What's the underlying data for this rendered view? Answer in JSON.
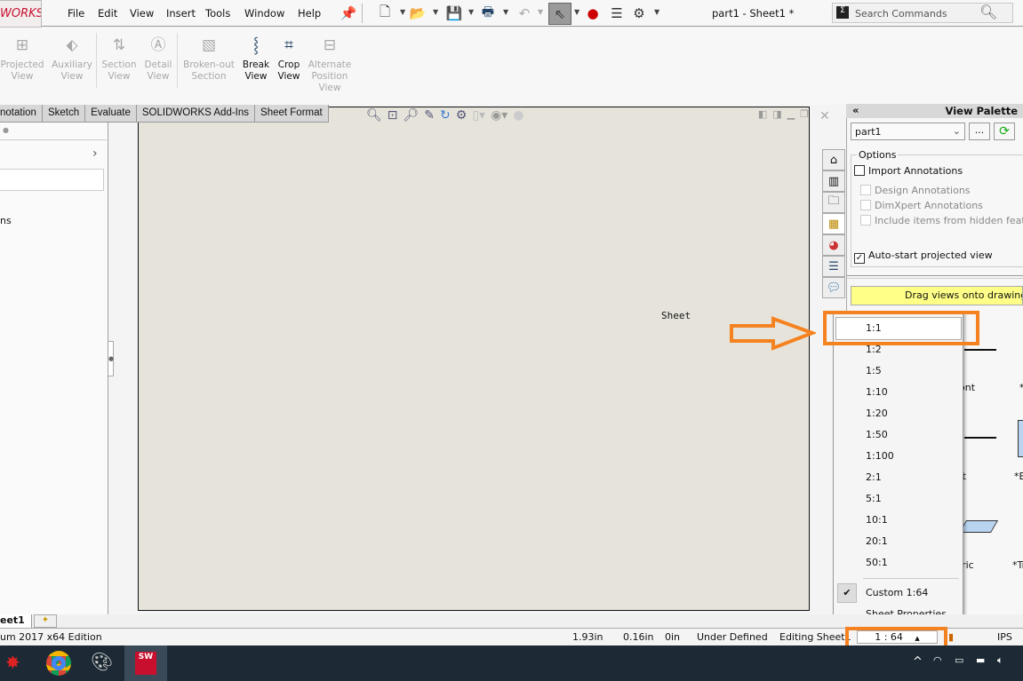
{
  "app": {
    "logo_text": "WORKS",
    "document_title": "part1 - Sheet1 *"
  },
  "menu": [
    "File",
    "Edit",
    "View",
    "Insert",
    "Tools",
    "Window",
    "Help"
  ],
  "search": {
    "placeholder": "Search Commands"
  },
  "ribbon": [
    {
      "label": "Projected View",
      "enabled": false
    },
    {
      "label": "Auxiliary View",
      "enabled": false
    },
    {
      "label": "Section View",
      "enabled": false
    },
    {
      "label": "Detail View",
      "enabled": false
    },
    {
      "label": "Broken-out Section",
      "enabled": false
    },
    {
      "label": "Break View",
      "enabled": true
    },
    {
      "label": "Crop View",
      "enabled": true
    },
    {
      "label": "Alternate Position View",
      "enabled": false
    }
  ],
  "tabs": [
    "notation",
    "Sketch",
    "Evaluate",
    "SOLIDWORKS Add-Ins",
    "Sheet Format"
  ],
  "left_panel": {
    "partial_text": "ns"
  },
  "graphics": {
    "sheet_label": "Sheet"
  },
  "view_palette": {
    "title": "View Palette",
    "collapse": "«",
    "part_select": "part1",
    "browse": "...",
    "options_label": "Options",
    "import_annotations": {
      "label": "Import Annotations",
      "checked": false
    },
    "sub_options": [
      {
        "label": "Design Annotations",
        "checked": false
      },
      {
        "label": "DimXpert Annotations",
        "checked": false
      },
      {
        "label": "Include items from hidden features",
        "checked": false
      }
    ],
    "auto_start": {
      "label": "Auto-start projected view",
      "checked": true
    },
    "hint": "Drag views onto drawing sheet",
    "view_labels": [
      "ont",
      "*",
      "ft",
      "*B",
      "etric",
      "*Tr"
    ]
  },
  "scale_dropdown": {
    "options": [
      "1:1",
      "1:2",
      "1:5",
      "1:10",
      "1:20",
      "1:50",
      "1:100",
      "2:1",
      "5:1",
      "10:1",
      "20:1",
      "50:1"
    ],
    "highlighted": "1:1",
    "custom": {
      "label": "Custom 1:64",
      "checked": true
    },
    "sheet_properties": "Sheet Properties..."
  },
  "sheet_tabs": [
    "eet1"
  ],
  "status_bar": {
    "edition": "um 2017 x64 Edition",
    "x": "1.93in",
    "y": "0.16in",
    "z": "0in",
    "state": "Under Defined",
    "editing": "Editing Sheet1",
    "scale": "1 : 64",
    "units": "IPS"
  },
  "colors": {
    "accent_orange": "#f58220",
    "hint_yellow": "#ffff88",
    "sheet_bg": "#e6e4da",
    "taskbar": "#1d2a35"
  }
}
